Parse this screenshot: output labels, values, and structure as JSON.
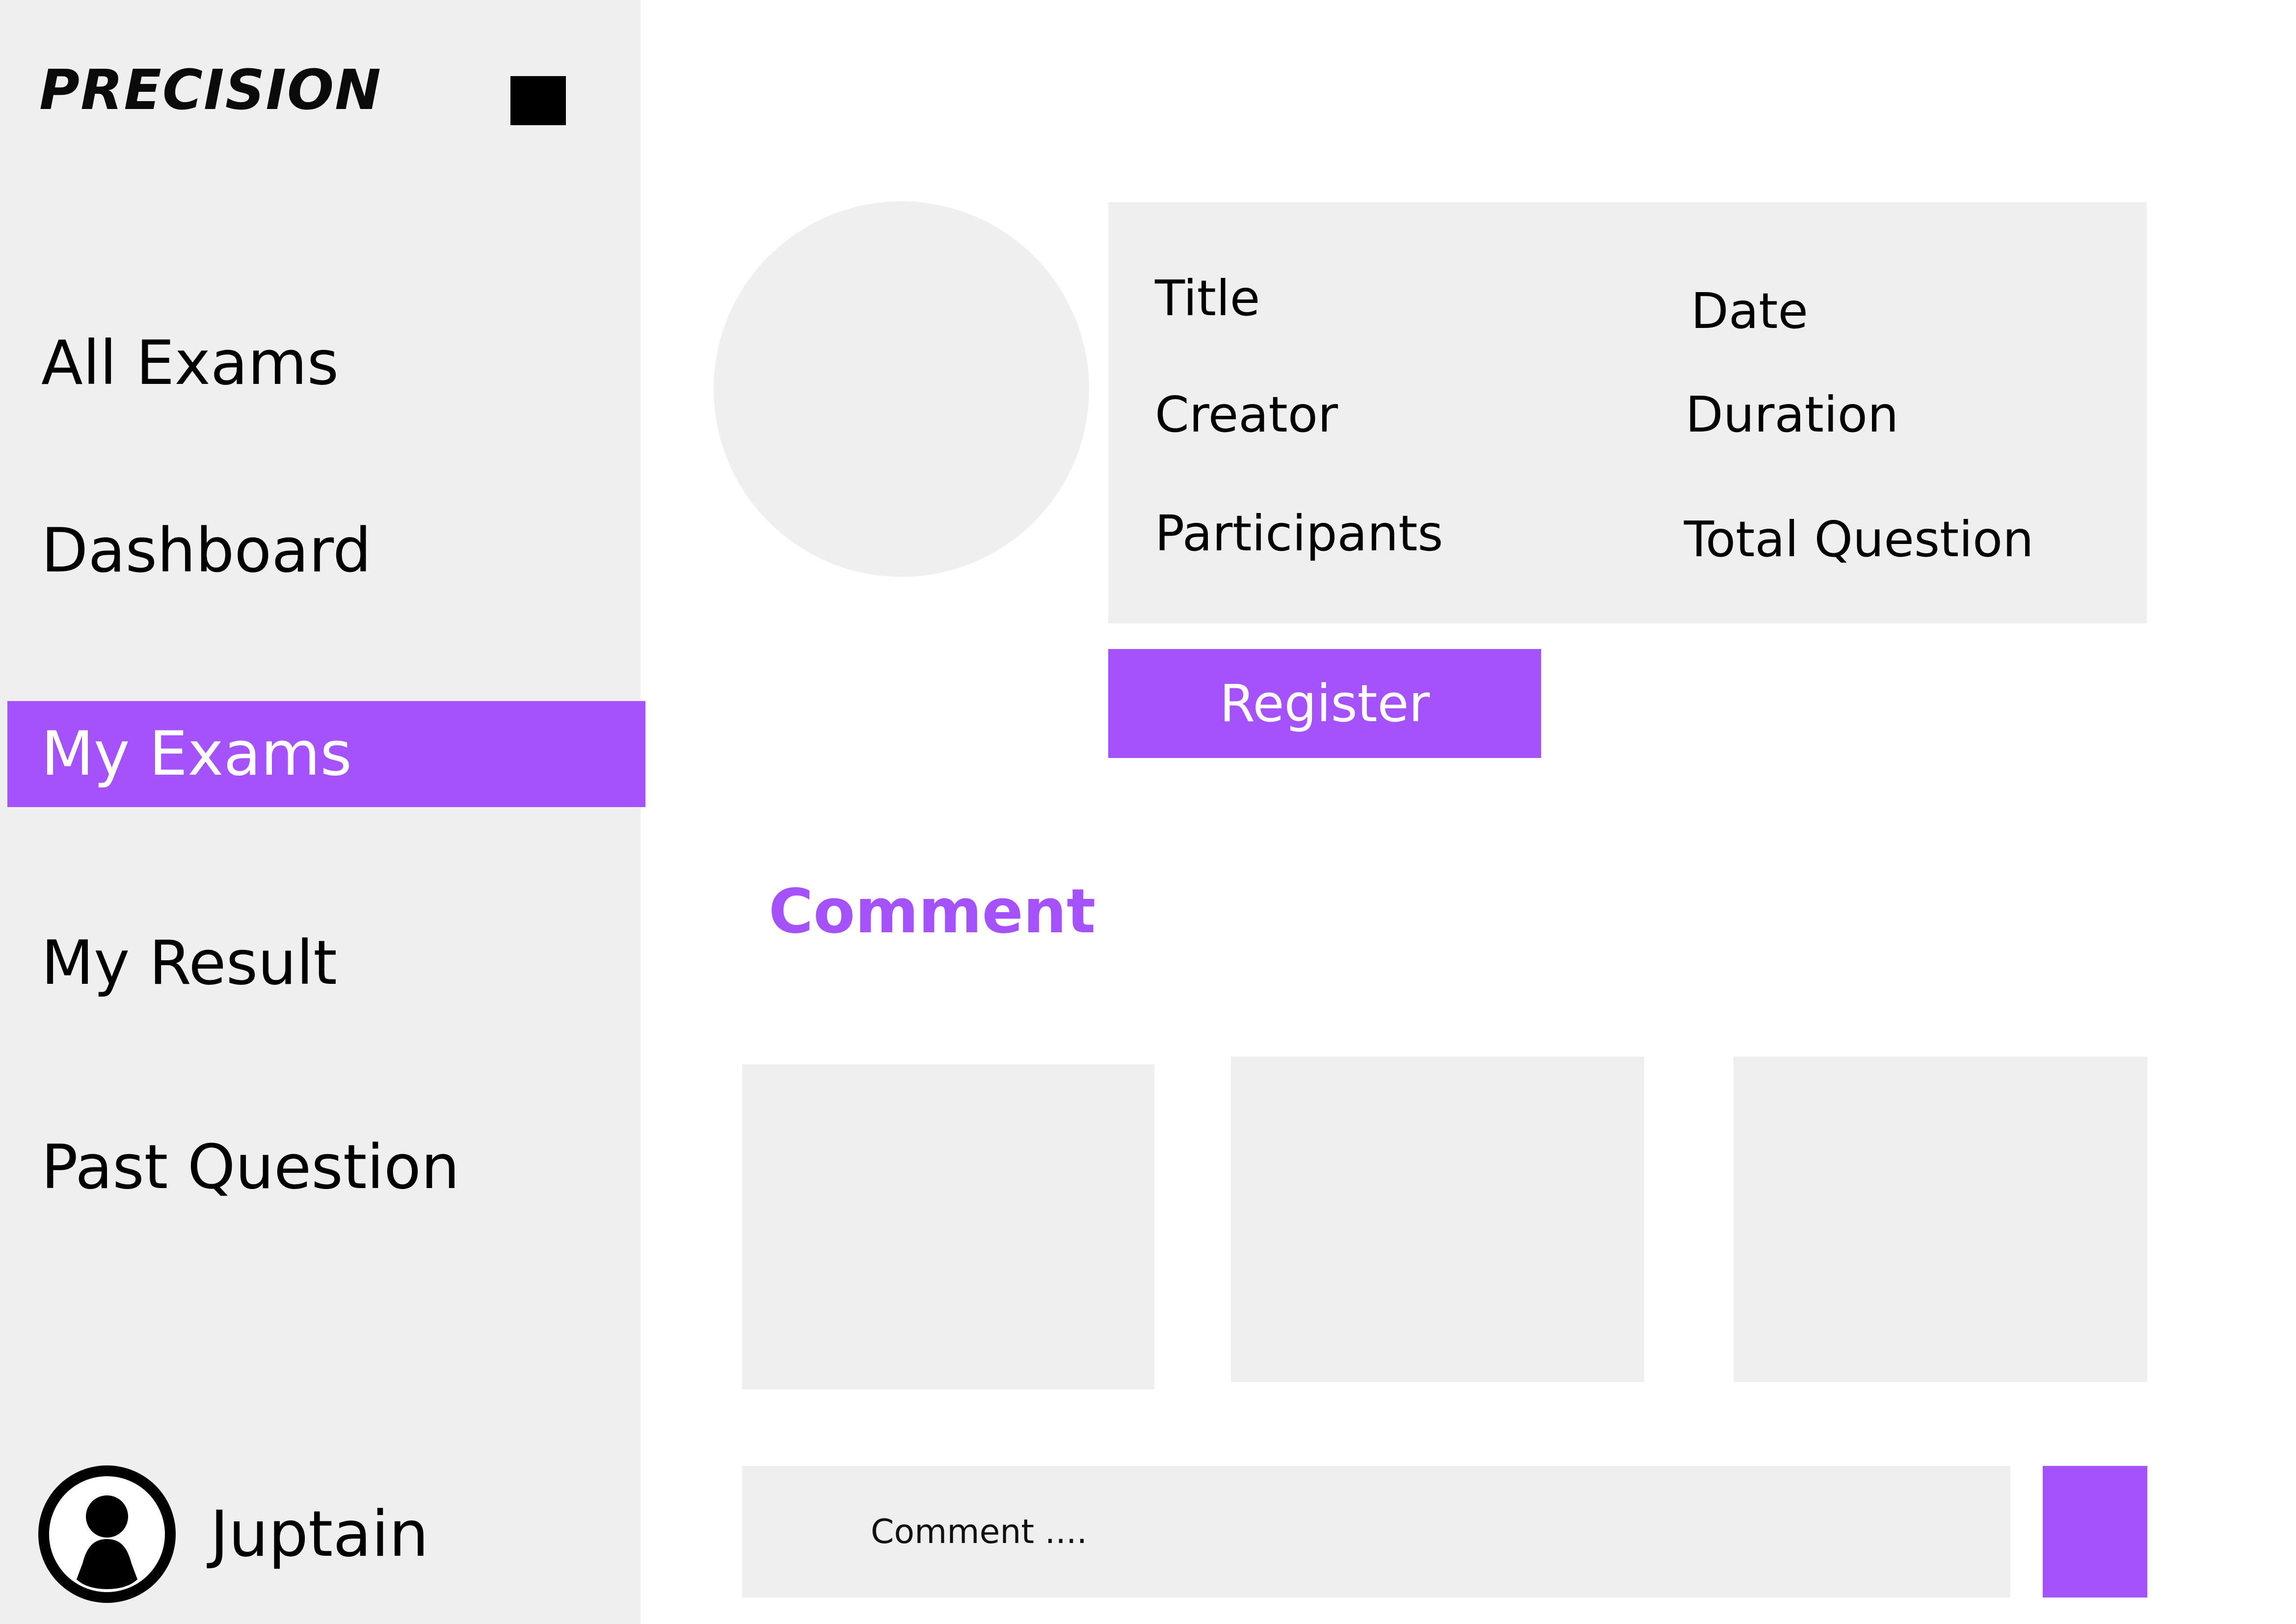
{
  "app": {
    "logo_text": "PRECISION"
  },
  "sidebar": {
    "items": [
      {
        "label": "All Exams",
        "active": false
      },
      {
        "label": "Dashboard",
        "active": false
      },
      {
        "label": "My Exams",
        "active": true
      },
      {
        "label": "My Result",
        "active": false
      },
      {
        "label": "Past Question",
        "active": false
      }
    ],
    "user": {
      "name": "Juptain"
    }
  },
  "exam_info": {
    "title_label": "Title",
    "date_label": "Date",
    "creator_label": "Creator",
    "duration_label": "Duration",
    "participants_label": "Participants",
    "total_question_label": "Total Question"
  },
  "actions": {
    "register_label": "Register"
  },
  "comments": {
    "heading": "Comment",
    "input_placeholder": "Comment ...."
  },
  "colors": {
    "accent": "#a352fc",
    "panel": "#efefef",
    "text": "#000000"
  }
}
